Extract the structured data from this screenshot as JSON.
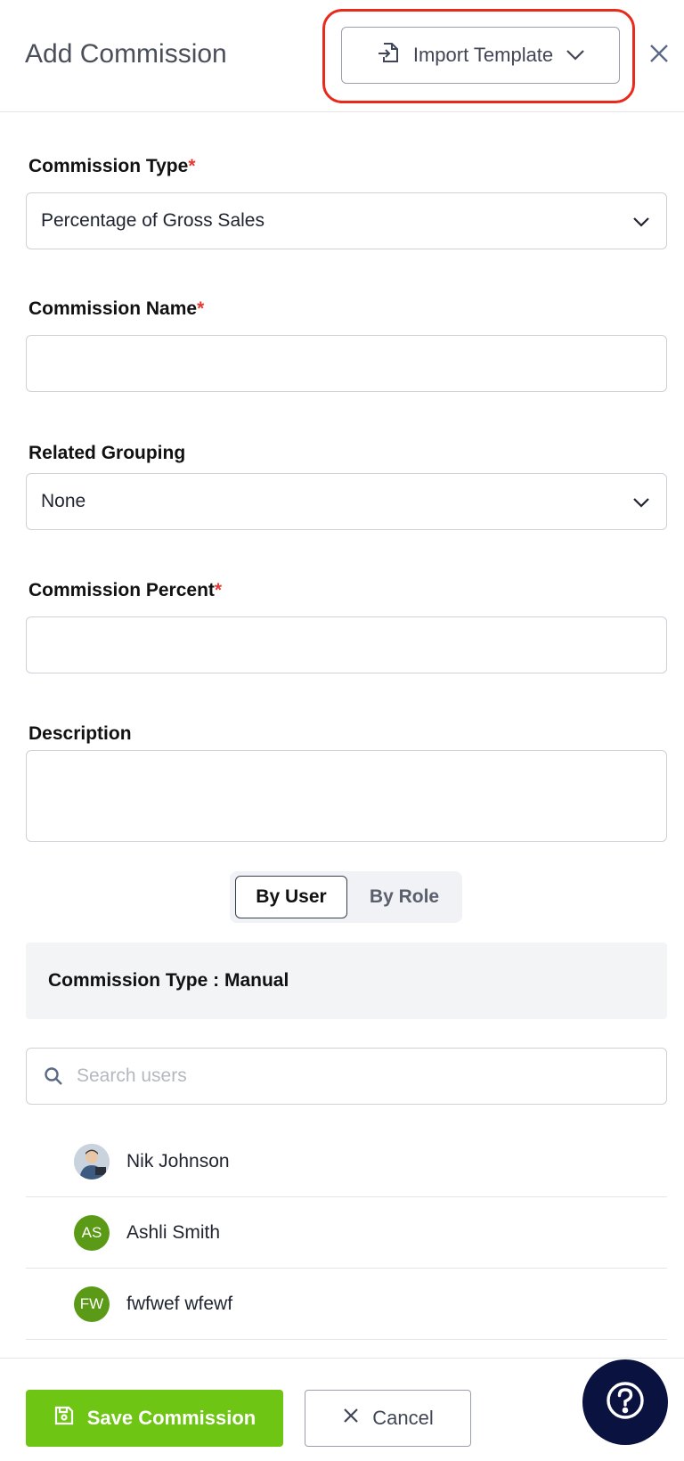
{
  "header": {
    "title": "Add Commission",
    "import_label": "Import Template"
  },
  "form": {
    "commission_type": {
      "label": "Commission Type",
      "required_mark": "*",
      "value": "Percentage of Gross Sales"
    },
    "commission_name": {
      "label": "Commission Name",
      "required_mark": "*",
      "value": ""
    },
    "related_grouping": {
      "label": "Related Grouping",
      "value": "None"
    },
    "commission_percent": {
      "label": "Commission Percent",
      "required_mark": "*",
      "value": ""
    },
    "description": {
      "label": "Description",
      "value": ""
    }
  },
  "assign_toggle": {
    "by_user": "By User",
    "by_role": "By Role",
    "selected": "By User"
  },
  "commission_type_panel": {
    "text": "Commission Type : Manual"
  },
  "search": {
    "placeholder": "Search users",
    "value": ""
  },
  "users": [
    {
      "name": "Nik Johnson",
      "initials": "",
      "avatar": "photo",
      "color": "#b7c4d3"
    },
    {
      "name": "Ashli Smith",
      "initials": "AS",
      "avatar": "initials",
      "color": "#5b9a16"
    },
    {
      "name": "fwfwef wfewf",
      "initials": "FW",
      "avatar": "initials",
      "color": "#5b9a16"
    }
  ],
  "partial_user_avatar_color": "#9b4fc9",
  "footer": {
    "save_label": "Save Commission",
    "cancel_label": "Cancel"
  },
  "colors": {
    "accent_green": "#6ec514",
    "highlight_red": "#e8291c",
    "required_red": "#e53935",
    "help_navy": "#0a1240"
  },
  "icons": {
    "import": "import-file-icon",
    "dropdown": "chevron-down-icon",
    "close": "close-icon",
    "search": "search-icon",
    "save": "save-icon",
    "cancel": "x-icon",
    "help": "help-icon"
  }
}
